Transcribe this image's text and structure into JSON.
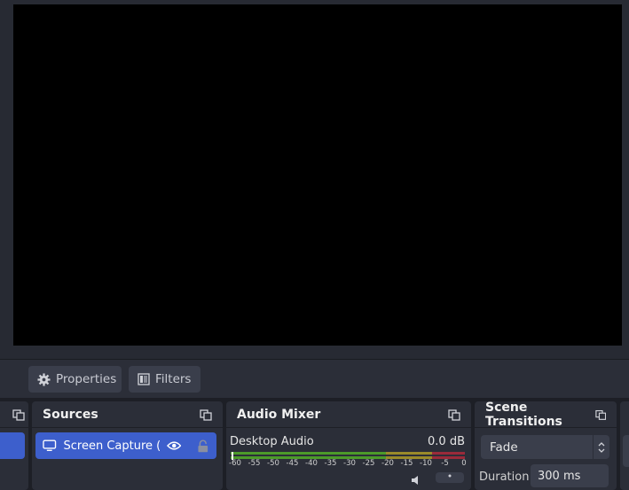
{
  "toolbar": {
    "properties_label": "Properties",
    "filters_label": "Filters"
  },
  "docks": {
    "sources": {
      "title": "Sources",
      "items": [
        {
          "name": "Screen Capture (Pi",
          "visible_icon": "eye-icon",
          "lock_icon": "lock-icon"
        }
      ]
    },
    "audio_mixer": {
      "title": "Audio Mixer",
      "channels": [
        {
          "name": "Desktop Audio",
          "level": "0.0 dB"
        }
      ],
      "scale": [
        "-60",
        "-55",
        "-50",
        "-45",
        "-40",
        "-35",
        "-30",
        "-25",
        "-20",
        "-15",
        "-10",
        "-5",
        "0"
      ]
    },
    "scene_transitions": {
      "title": "Scene Transitions",
      "selected": "Fade",
      "duration_label": "Duration",
      "duration_value": "300 ms"
    }
  },
  "colors": {
    "background": "#1d1f26",
    "panel": "#2b2e38",
    "accent": "#3d5fcc",
    "meter_green": "#4c9a2a",
    "meter_yellow": "#9a8a2a",
    "meter_red": "#9a2a3a"
  }
}
